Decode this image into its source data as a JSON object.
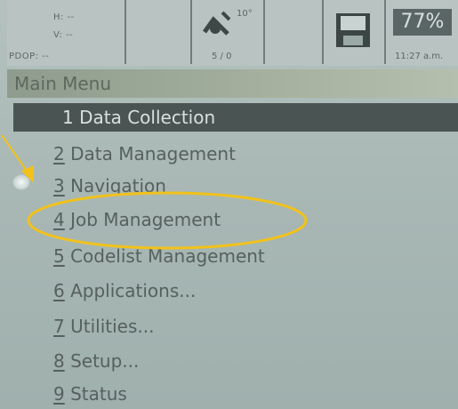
{
  "status_bar": {
    "gnss": {
      "h_label": "H: --",
      "v_label": "V: --",
      "pdop_label": "PDOP: --"
    },
    "satellites": {
      "elevation": "10°",
      "count": "5 / 0"
    },
    "battery": {
      "percent": "77%"
    },
    "clock": "11:27 a.m."
  },
  "title": "Main Menu",
  "menu": {
    "items": [
      {
        "num": "1",
        "label": "Data Collection"
      },
      {
        "num": "2",
        "label": "Data Management"
      },
      {
        "num": "3",
        "label": "Navigation"
      },
      {
        "num": "4",
        "label": "Job Management"
      },
      {
        "num": "5",
        "label": "Codelist Management"
      },
      {
        "num": "6",
        "label": "Applications..."
      },
      {
        "num": "7",
        "label": "Utilities..."
      },
      {
        "num": "8",
        "label": "Setup..."
      },
      {
        "num": "9",
        "label": "Status"
      }
    ],
    "selected_index": 0
  },
  "annotation": {
    "highlight_color": "#f2c21a",
    "highlighted_item": "4 Job Management"
  },
  "icons": [
    "satellite-icon",
    "floppy-disk-icon",
    "battery-icon",
    "arrow-annotation-icon"
  ]
}
